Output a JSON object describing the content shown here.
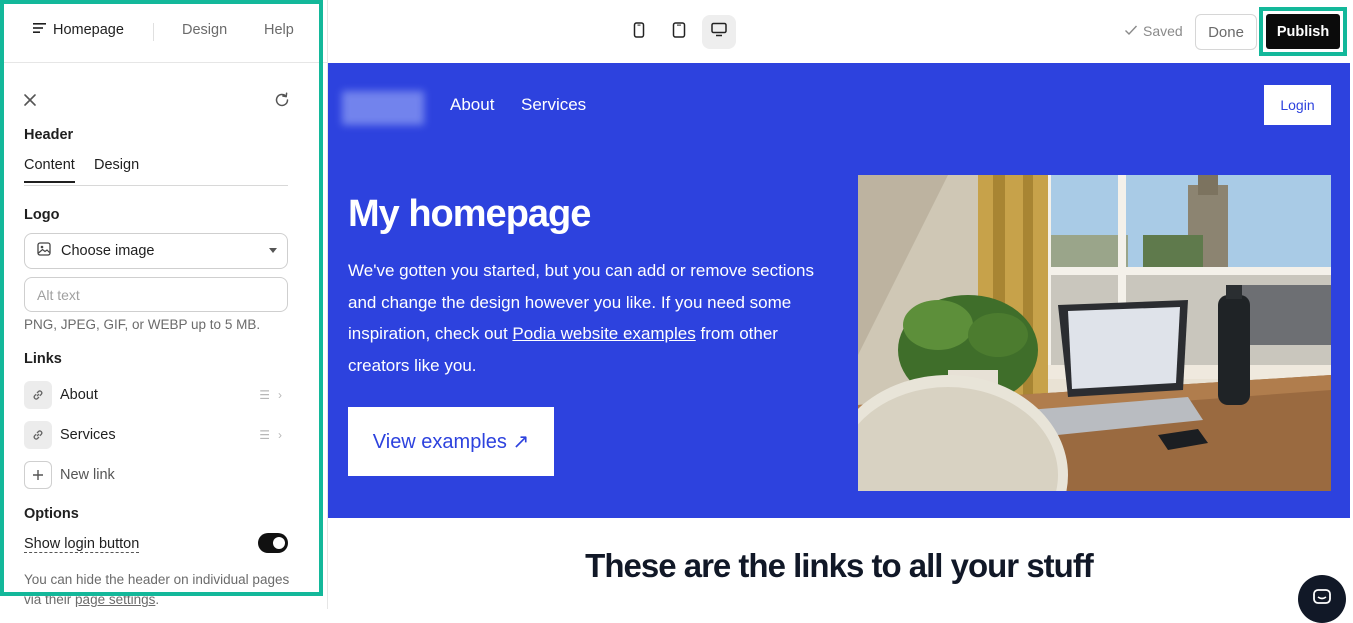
{
  "sidebar": {
    "tabs": {
      "homepage": "Homepage",
      "design": "Design",
      "help": "Help"
    },
    "section_title": "Header",
    "subtabs": {
      "content": "Content",
      "design": "Design"
    },
    "logo": {
      "title": "Logo",
      "choose_label": "Choose image",
      "alt_placeholder": "Alt text",
      "hint": "PNG, JPEG, GIF, or WEBP up to 5 MB."
    },
    "links": {
      "title": "Links",
      "items": [
        {
          "label": "About"
        },
        {
          "label": "Services"
        }
      ],
      "new_link": "New link"
    },
    "options": {
      "title": "Options",
      "show_login_label": "Show login button",
      "show_login_on": true,
      "footer_text": "You can hide the header on individual pages via their",
      "footer_link": "page settings",
      "footer_end": "."
    }
  },
  "toolbar": {
    "saved_label": "Saved",
    "done_label": "Done",
    "publish_label": "Publish",
    "active_device": "desktop"
  },
  "preview": {
    "nav": {
      "about": "About",
      "services": "Services",
      "login": "Login"
    },
    "hero": {
      "title": "My homepage",
      "text_before": "We've gotten you started, but you can add or remove sections and change the design however you like. If you need some inspiration, check out ",
      "link": "Podia website examples",
      "text_after": " from other creators like you.",
      "button": "View examples ↗"
    },
    "section_heading": "These are the links to all your stuff"
  },
  "colors": {
    "accent_highlight": "#13b89a",
    "hero_bg": "#2d42de",
    "publish_bg": "#0b0b0b"
  }
}
